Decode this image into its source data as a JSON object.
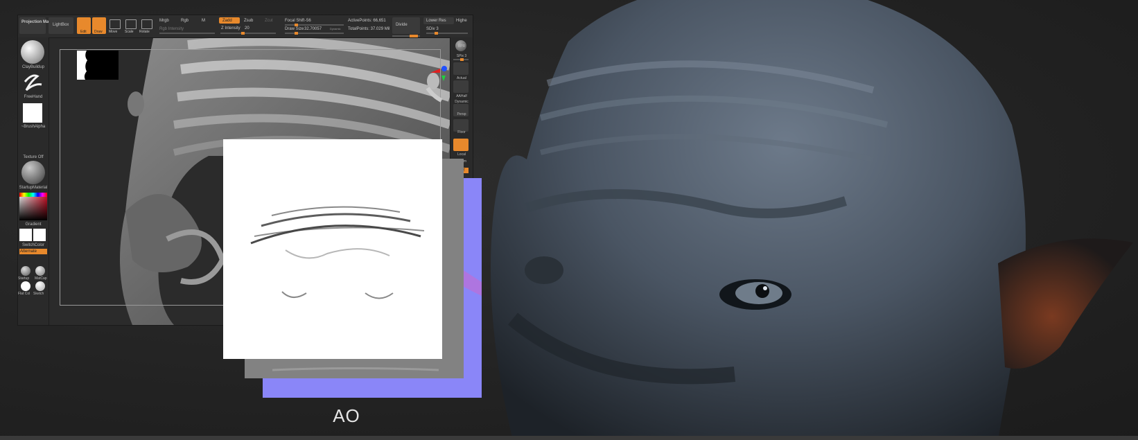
{
  "toolbar": {
    "projection_master": "Projection Master",
    "lightbox": "LightBox",
    "edit": "Edit",
    "draw": "Draw",
    "move": "Move",
    "scale": "Scale",
    "rotate": "Rotate",
    "mrgb": "Mrgb",
    "rgb": "Rgb",
    "m": "M",
    "rgb_intensity": "Rgb Intensity",
    "zadd": "Zadd",
    "zsub": "Zsub",
    "zcut": "Zcut",
    "z_intensity_label": "Z Intensity",
    "z_intensity_value": "20",
    "focal_shift_label": "Focal Shift",
    "focal_shift_value": "-56",
    "draw_size_label": "Draw Size",
    "draw_size_value": "32.70057",
    "dynamic": "Dynamic",
    "active_points": "ActivePoints: 66,651",
    "total_points": "TotalPoints: 37.029 Mil",
    "divide": "Divide",
    "lower_res": "Lower Res",
    "higher": "Highe",
    "sdiv": "SDiv 3"
  },
  "left_shelf": {
    "brush": "ClayBuildup",
    "stroke": "FreeHand",
    "alpha": "~BrushAlpha",
    "texture": "Texture Off",
    "material": "StartupMaterial",
    "gradient": "Gradient",
    "switch_color": "SwitchColor",
    "alternate": "Alternate",
    "mat1": "Startup",
    "mat2": "MatCap",
    "mat3": "Flat Col",
    "mat4": "Sketch"
  },
  "right_shelf": {
    "bpr": "BPR",
    "spix": "SPix 3",
    "actual": "Actual",
    "aahalf": "AAHalf",
    "dynamic": "Dynamic",
    "persp": "Persp",
    "floor": "Floor",
    "local": "Local",
    "lsym": "L.Sym",
    "xyz": "XYZ"
  },
  "caption": "AO",
  "colors": {
    "accent": "#e8892c",
    "normal_map": "#8a86f8",
    "ui_bg": "#2a2a2a"
  }
}
